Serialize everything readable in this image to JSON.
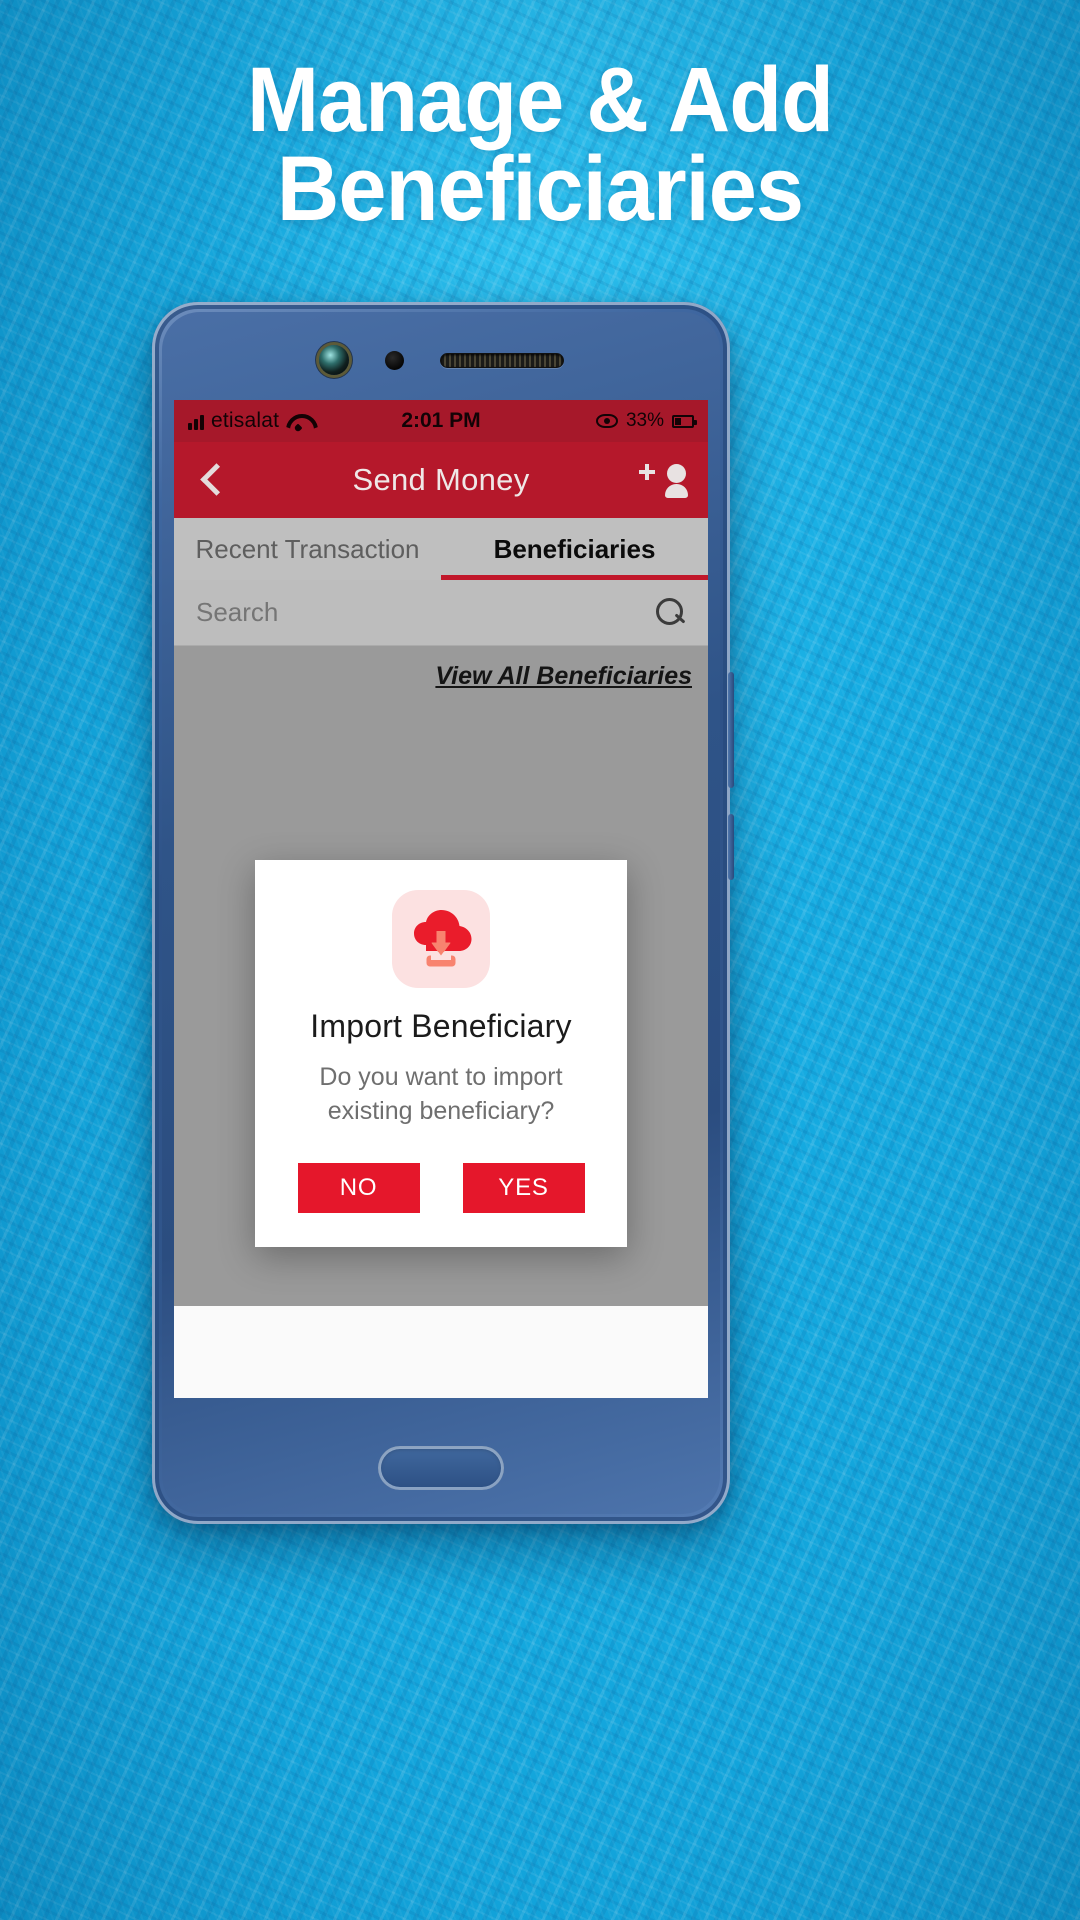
{
  "promo": {
    "headline_line1": "Manage & Add",
    "headline_line2": "Beneficiaries"
  },
  "colors": {
    "background": "#19B2E6",
    "brand_red": "#B5182B",
    "status_red": "#A6182A",
    "accent_red": "#E5172B",
    "icon_pink_bg": "#FCE1E1"
  },
  "status_bar": {
    "carrier": "etisalat",
    "time": "2:01 PM",
    "battery_percent": "33%",
    "signal_icon": "signal-bars-icon",
    "wifi_icon": "wifi-icon",
    "eye_icon": "eye-icon",
    "battery_icon": "battery-icon"
  },
  "app_bar": {
    "back_icon": "back-chevron-icon",
    "title": "Send Money",
    "add_icon": "add-person-icon"
  },
  "tabs": [
    {
      "label": "Recent Transaction",
      "active": false
    },
    {
      "label": "Beneficiaries",
      "active": true
    }
  ],
  "search": {
    "placeholder": "Search",
    "value": "",
    "icon": "search-icon"
  },
  "content": {
    "view_all_label": "View All Beneficiaries"
  },
  "dialog": {
    "icon": "cloud-download-icon",
    "title": "Import Beneficiary",
    "message": "Do you want to import existing beneficiary?",
    "buttons": [
      {
        "label": "NO",
        "name": "no-button"
      },
      {
        "label": "YES",
        "name": "yes-button"
      }
    ]
  }
}
